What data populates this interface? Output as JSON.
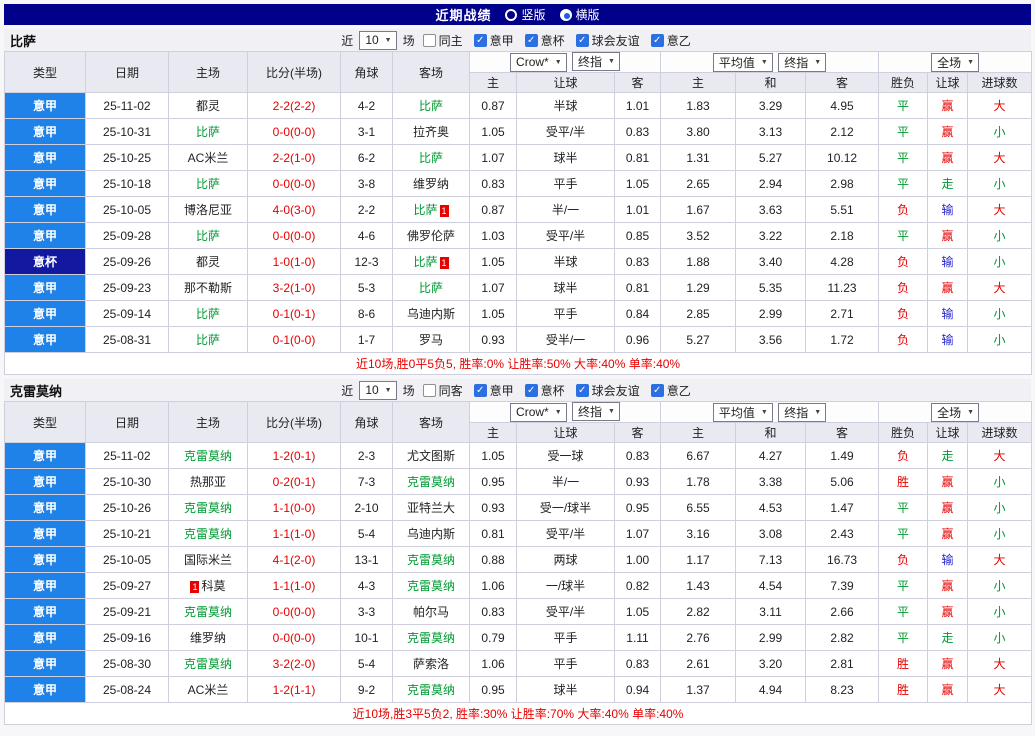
{
  "header": {
    "title": "近期战绩",
    "modes": [
      {
        "label": "竖版",
        "selected": false
      },
      {
        "label": "横版",
        "selected": true
      }
    ]
  },
  "colors": {
    "topbar_navy": "#00008b",
    "league_blue": "#1e82e8",
    "cup_navy": "#1218a0",
    "win_red": "#e60000",
    "draw_green": "#009933",
    "loss_blue": "#2323cc"
  },
  "cols": {
    "type": "类型",
    "date": "日期",
    "home": "主场",
    "score": "比分(半场)",
    "corner": "角球",
    "away": "客场",
    "odds_home": "主",
    "odds_hcap": "让球",
    "odds_away": "客",
    "avg_home": "主",
    "avg_draw": "和",
    "avg_away": "客",
    "res_wdl": "胜负",
    "res_hcap": "让球",
    "res_goals": "进球数"
  },
  "sections": [
    {
      "team": "比萨",
      "filter": {
        "prefix": "近",
        "count": "10",
        "suffix": "场",
        "same": {
          "label": "同主",
          "checked": false
        },
        "leagues": [
          {
            "label": "意甲",
            "checked": true
          },
          {
            "label": "意杯",
            "checked": true
          },
          {
            "label": "球会友谊",
            "checked": true
          },
          {
            "label": "意乙",
            "checked": true
          }
        ]
      },
      "selects": {
        "book": "Crow*",
        "book_kind": "终指",
        "avg": "平均值",
        "avg_kind": "终指",
        "scope": "全场"
      },
      "rows": [
        {
          "type": "意甲",
          "date": "25-11-02",
          "home": {
            "t": "都灵"
          },
          "score": "2-2(2-2)",
          "corner": "4-2",
          "away": {
            "t": "比萨",
            "g": true
          },
          "o": [
            "0.87",
            "半球",
            "1.01"
          ],
          "a": [
            "1.83",
            "3.29",
            "4.95"
          ],
          "r": [
            [
              "平",
              "g"
            ],
            [
              "赢",
              "r"
            ],
            [
              "大",
              "r"
            ]
          ]
        },
        {
          "type": "意甲",
          "date": "25-10-31",
          "home": {
            "t": "比萨",
            "g": true
          },
          "score": "0-0(0-0)",
          "corner": "3-1",
          "away": {
            "t": "拉齐奥"
          },
          "o": [
            "1.05",
            "受平/半",
            "0.83"
          ],
          "a": [
            "3.80",
            "3.13",
            "2.12"
          ],
          "r": [
            [
              "平",
              "g"
            ],
            [
              "赢",
              "r"
            ],
            [
              "小",
              "g"
            ]
          ]
        },
        {
          "type": "意甲",
          "date": "25-10-25",
          "home": {
            "t": "AC米兰"
          },
          "score": "2-2(1-0)",
          "corner": "6-2",
          "away": {
            "t": "比萨",
            "g": true
          },
          "o": [
            "1.07",
            "球半",
            "0.81"
          ],
          "a": [
            "1.31",
            "5.27",
            "10.12"
          ],
          "r": [
            [
              "平",
              "g"
            ],
            [
              "赢",
              "r"
            ],
            [
              "大",
              "r"
            ]
          ]
        },
        {
          "type": "意甲",
          "date": "25-10-18",
          "home": {
            "t": "比萨",
            "g": true
          },
          "score": "0-0(0-0)",
          "corner": "3-8",
          "away": {
            "t": "维罗纳"
          },
          "o": [
            "0.83",
            "平手",
            "1.05"
          ],
          "a": [
            "2.65",
            "2.94",
            "2.98"
          ],
          "r": [
            [
              "平",
              "g"
            ],
            [
              "走",
              "g"
            ],
            [
              "小",
              "g"
            ]
          ]
        },
        {
          "type": "意甲",
          "date": "25-10-05",
          "home": {
            "t": "博洛尼亚"
          },
          "score": "4-0(3-0)",
          "corner": "2-2",
          "away": {
            "t": "比萨",
            "g": true,
            "rc": "1"
          },
          "o": [
            "0.87",
            "半/一",
            "1.01"
          ],
          "a": [
            "1.67",
            "3.63",
            "5.51"
          ],
          "r": [
            [
              "负",
              "r"
            ],
            [
              "输",
              "b"
            ],
            [
              "大",
              "r"
            ]
          ]
        },
        {
          "type": "意甲",
          "date": "25-09-28",
          "home": {
            "t": "比萨",
            "g": true
          },
          "score": "0-0(0-0)",
          "corner": "4-6",
          "away": {
            "t": "佛罗伦萨"
          },
          "o": [
            "1.03",
            "受平/半",
            "0.85"
          ],
          "a": [
            "3.52",
            "3.22",
            "2.18"
          ],
          "r": [
            [
              "平",
              "g"
            ],
            [
              "赢",
              "r"
            ],
            [
              "小",
              "g"
            ]
          ]
        },
        {
          "type": "意杯",
          "dark": true,
          "date": "25-09-26",
          "home": {
            "t": "都灵"
          },
          "score": "1-0(1-0)",
          "corner": "12-3",
          "away": {
            "t": "比萨",
            "g": true,
            "rc": "1"
          },
          "o": [
            "1.05",
            "半球",
            "0.83"
          ],
          "a": [
            "1.88",
            "3.40",
            "4.28"
          ],
          "r": [
            [
              "负",
              "r"
            ],
            [
              "输",
              "b"
            ],
            [
              "小",
              "g"
            ]
          ]
        },
        {
          "type": "意甲",
          "date": "25-09-23",
          "home": {
            "t": "那不勒斯"
          },
          "score": "3-2(1-0)",
          "corner": "5-3",
          "away": {
            "t": "比萨",
            "g": true
          },
          "o": [
            "1.07",
            "球半",
            "0.81"
          ],
          "a": [
            "1.29",
            "5.35",
            "11.23"
          ],
          "r": [
            [
              "负",
              "r"
            ],
            [
              "赢",
              "r"
            ],
            [
              "大",
              "r"
            ]
          ]
        },
        {
          "type": "意甲",
          "date": "25-09-14",
          "home": {
            "t": "比萨",
            "g": true
          },
          "score": "0-1(0-1)",
          "corner": "8-6",
          "away": {
            "t": "乌迪内斯"
          },
          "o": [
            "1.05",
            "平手",
            "0.84"
          ],
          "a": [
            "2.85",
            "2.99",
            "2.71"
          ],
          "r": [
            [
              "负",
              "r"
            ],
            [
              "输",
              "b"
            ],
            [
              "小",
              "g"
            ]
          ]
        },
        {
          "type": "意甲",
          "date": "25-08-31",
          "home": {
            "t": "比萨",
            "g": true
          },
          "score": "0-1(0-0)",
          "corner": "1-7",
          "away": {
            "t": "罗马"
          },
          "o": [
            "0.93",
            "受半/一",
            "0.96"
          ],
          "a": [
            "5.27",
            "3.56",
            "1.72"
          ],
          "r": [
            [
              "负",
              "r"
            ],
            [
              "输",
              "b"
            ],
            [
              "小",
              "g"
            ]
          ]
        }
      ],
      "summary": "近10场,胜0平5负5, 胜率:0% 让胜率:50% 大率:40% 单率:40%"
    },
    {
      "team": "克雷莫纳",
      "filter": {
        "prefix": "近",
        "count": "10",
        "suffix": "场",
        "same": {
          "label": "同客",
          "checked": false
        },
        "leagues": [
          {
            "label": "意甲",
            "checked": true
          },
          {
            "label": "意杯",
            "checked": true
          },
          {
            "label": "球会友谊",
            "checked": true
          },
          {
            "label": "意乙",
            "checked": true
          }
        ]
      },
      "selects": {
        "book": "Crow*",
        "book_kind": "终指",
        "avg": "平均值",
        "avg_kind": "终指",
        "scope": "全场"
      },
      "rows": [
        {
          "type": "意甲",
          "date": "25-11-02",
          "home": {
            "t": "克雷莫纳",
            "g": true
          },
          "score": "1-2(0-1)",
          "corner": "2-3",
          "away": {
            "t": "尤文图斯"
          },
          "o": [
            "1.05",
            "受一球",
            "0.83"
          ],
          "a": [
            "6.67",
            "4.27",
            "1.49"
          ],
          "r": [
            [
              "负",
              "r"
            ],
            [
              "走",
              "g"
            ],
            [
              "大",
              "r"
            ]
          ]
        },
        {
          "type": "意甲",
          "date": "25-10-30",
          "home": {
            "t": "热那亚"
          },
          "score": "0-2(0-1)",
          "corner": "7-3",
          "away": {
            "t": "克雷莫纳",
            "g": true
          },
          "o": [
            "0.95",
            "半/一",
            "0.93"
          ],
          "a": [
            "1.78",
            "3.38",
            "5.06"
          ],
          "r": [
            [
              "胜",
              "r"
            ],
            [
              "赢",
              "r"
            ],
            [
              "小",
              "g"
            ]
          ]
        },
        {
          "type": "意甲",
          "date": "25-10-26",
          "home": {
            "t": "克雷莫纳",
            "g": true
          },
          "score": "1-1(0-0)",
          "corner": "2-10",
          "away": {
            "t": "亚特兰大"
          },
          "o": [
            "0.93",
            "受一/球半",
            "0.95"
          ],
          "a": [
            "6.55",
            "4.53",
            "1.47"
          ],
          "r": [
            [
              "平",
              "g"
            ],
            [
              "赢",
              "r"
            ],
            [
              "小",
              "g"
            ]
          ]
        },
        {
          "type": "意甲",
          "date": "25-10-21",
          "home": {
            "t": "克雷莫纳",
            "g": true
          },
          "score": "1-1(1-0)",
          "corner": "5-4",
          "away": {
            "t": "乌迪内斯"
          },
          "o": [
            "0.81",
            "受平/半",
            "1.07"
          ],
          "a": [
            "3.16",
            "3.08",
            "2.43"
          ],
          "r": [
            [
              "平",
              "g"
            ],
            [
              "赢",
              "r"
            ],
            [
              "小",
              "g"
            ]
          ]
        },
        {
          "type": "意甲",
          "date": "25-10-05",
          "home": {
            "t": "国际米兰"
          },
          "score": "4-1(2-0)",
          "corner": "13-1",
          "away": {
            "t": "克雷莫纳",
            "g": true
          },
          "o": [
            "0.88",
            "两球",
            "1.00"
          ],
          "a": [
            "1.17",
            "7.13",
            "16.73"
          ],
          "r": [
            [
              "负",
              "r"
            ],
            [
              "输",
              "b"
            ],
            [
              "大",
              "r"
            ]
          ]
        },
        {
          "type": "意甲",
          "date": "25-09-27",
          "home": {
            "t": "科莫",
            "rc": "1",
            "rb": true
          },
          "score": "1-1(1-0)",
          "corner": "4-3",
          "away": {
            "t": "克雷莫纳",
            "g": true
          },
          "o": [
            "1.06",
            "一/球半",
            "0.82"
          ],
          "a": [
            "1.43",
            "4.54",
            "7.39"
          ],
          "r": [
            [
              "平",
              "g"
            ],
            [
              "赢",
              "r"
            ],
            [
              "小",
              "g"
            ]
          ]
        },
        {
          "type": "意甲",
          "date": "25-09-21",
          "home": {
            "t": "克雷莫纳",
            "g": true
          },
          "score": "0-0(0-0)",
          "corner": "3-3",
          "away": {
            "t": "帕尔马"
          },
          "o": [
            "0.83",
            "受平/半",
            "1.05"
          ],
          "a": [
            "2.82",
            "3.11",
            "2.66"
          ],
          "r": [
            [
              "平",
              "g"
            ],
            [
              "赢",
              "r"
            ],
            [
              "小",
              "g"
            ]
          ]
        },
        {
          "type": "意甲",
          "date": "25-09-16",
          "home": {
            "t": "维罗纳"
          },
          "score": "0-0(0-0)",
          "corner": "10-1",
          "away": {
            "t": "克雷莫纳",
            "g": true
          },
          "o": [
            "0.79",
            "平手",
            "1.11"
          ],
          "a": [
            "2.76",
            "2.99",
            "2.82"
          ],
          "r": [
            [
              "平",
              "g"
            ],
            [
              "走",
              "g"
            ],
            [
              "小",
              "g"
            ]
          ]
        },
        {
          "type": "意甲",
          "date": "25-08-30",
          "home": {
            "t": "克雷莫纳",
            "g": true
          },
          "score": "3-2(2-0)",
          "corner": "5-4",
          "away": {
            "t": "萨索洛"
          },
          "o": [
            "1.06",
            "平手",
            "0.83"
          ],
          "a": [
            "2.61",
            "3.20",
            "2.81"
          ],
          "r": [
            [
              "胜",
              "r"
            ],
            [
              "赢",
              "r"
            ],
            [
              "大",
              "r"
            ]
          ]
        },
        {
          "type": "意甲",
          "date": "25-08-24",
          "home": {
            "t": "AC米兰"
          },
          "score": "1-2(1-1)",
          "corner": "9-2",
          "away": {
            "t": "克雷莫纳",
            "g": true
          },
          "o": [
            "0.95",
            "球半",
            "0.94"
          ],
          "a": [
            "1.37",
            "4.94",
            "8.23"
          ],
          "r": [
            [
              "胜",
              "r"
            ],
            [
              "赢",
              "r"
            ],
            [
              "大",
              "r"
            ]
          ]
        }
      ],
      "summary": "近10场,胜3平5负2, 胜率:30% 让胜率:70% 大率:40% 单率:40%"
    }
  ]
}
